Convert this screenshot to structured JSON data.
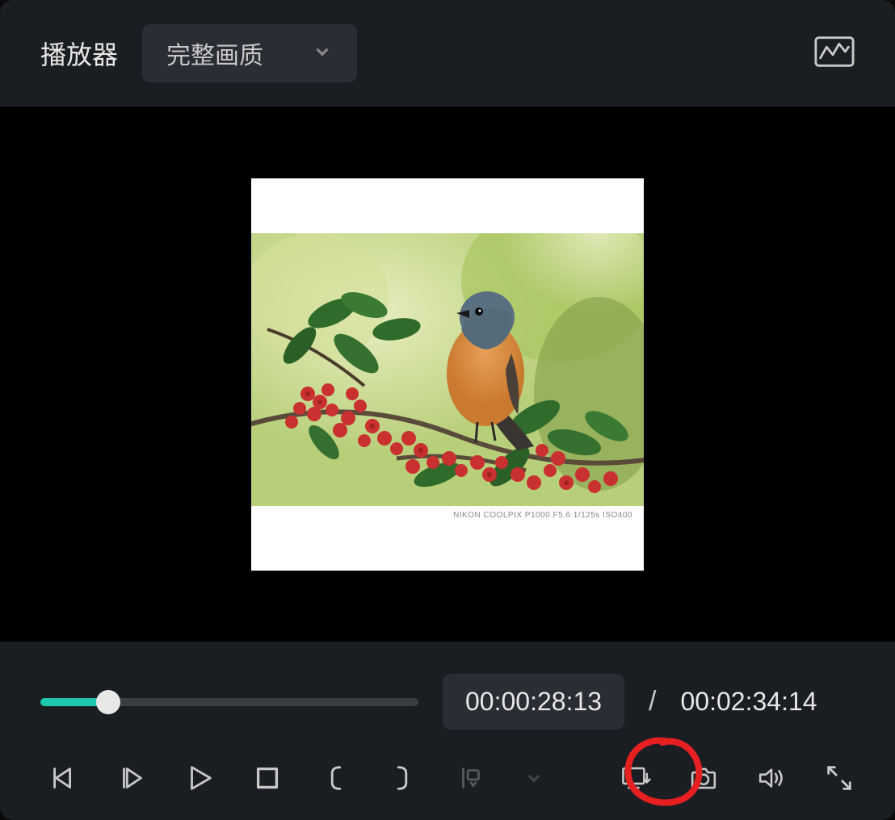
{
  "header": {
    "title": "播放器",
    "quality_selected": "完整画质"
  },
  "preview": {
    "caption": "NIKON COOLPIX P1000 F5.6 1/125s ISO400"
  },
  "playback": {
    "current_time": "00:00:28:13",
    "total_time": "00:02:34:14",
    "time_separator": "/",
    "progress_percent": 18
  },
  "colors": {
    "accent": "#1ec9b0",
    "annotation": "#e62020"
  }
}
